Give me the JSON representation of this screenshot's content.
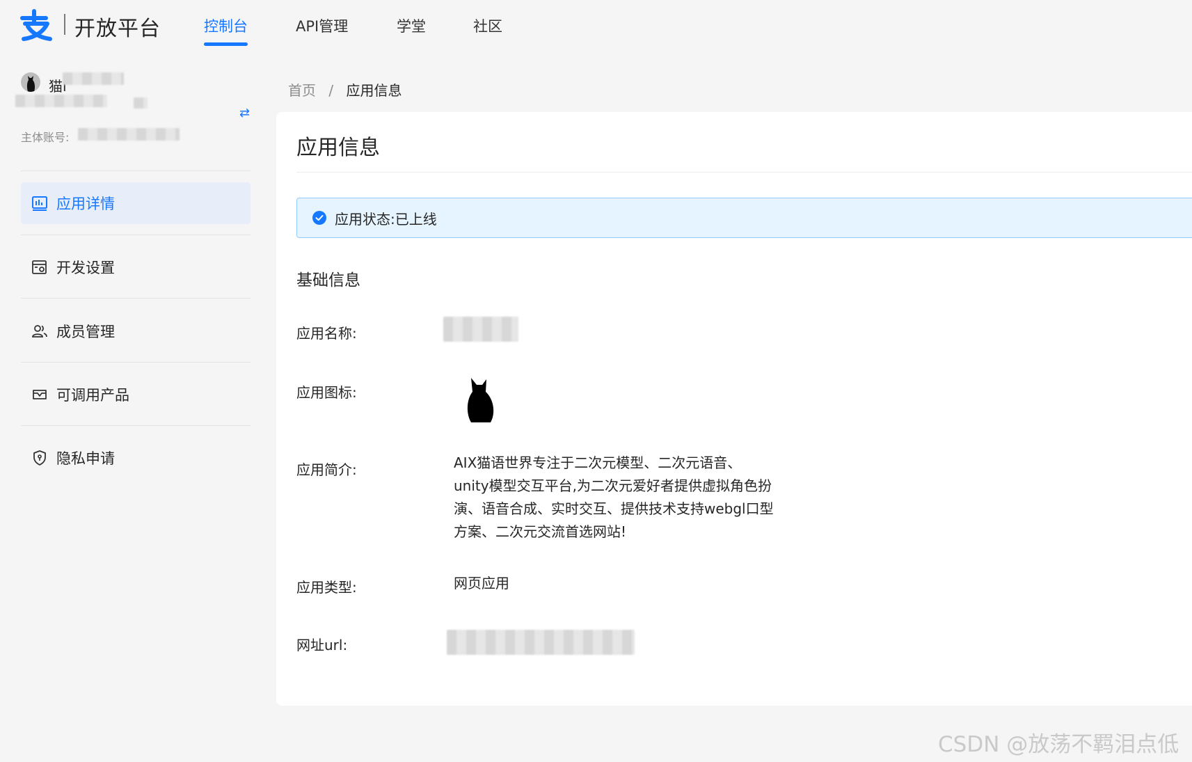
{
  "brand": {
    "logo_char": "支",
    "name": "开放平台",
    "accent_color": "#1677ff"
  },
  "nav": {
    "tabs": [
      {
        "label": "控制台",
        "active": true
      },
      {
        "label": "API管理",
        "active": false
      },
      {
        "label": "学堂",
        "active": false
      },
      {
        "label": "社区",
        "active": false
      }
    ]
  },
  "user": {
    "name_visible": "猫i",
    "account_label": "主体账号:",
    "avatar_icon": "cat-silhouette-icon",
    "switch_icon": "swap-icon"
  },
  "sidebar": {
    "items": [
      {
        "label": "应用详情",
        "icon": "chart-board-icon",
        "active": true
      },
      {
        "label": "开发设置",
        "icon": "settings-window-icon",
        "active": false
      },
      {
        "label": "成员管理",
        "icon": "users-icon",
        "active": false
      },
      {
        "label": "可调用产品",
        "icon": "product-icon",
        "active": false
      },
      {
        "label": "隐私申请",
        "icon": "shield-icon",
        "active": false
      }
    ]
  },
  "breadcrumb": {
    "home": "首页",
    "separator": "/",
    "current": "应用信息"
  },
  "main": {
    "title": "应用信息",
    "status": {
      "label": "应用状态:",
      "value": "已上线",
      "icon": "check-circle-icon",
      "bg_color": "#e6f4ff"
    },
    "section_title": "基础信息",
    "fields": {
      "name_label": "应用名称:",
      "icon_label": "应用图标:",
      "desc_label": "应用简介:",
      "desc_value": "AIX猫语世界专注于二次元模型、二次元语音、unity模型交互平台,为二次元爱好者提供虚拟角色扮演、语音合成、实时交互、提供技术支持webgl口型方案、二次元交流首选网站!",
      "type_label": "应用类型:",
      "type_value": "网页应用",
      "url_label": "网址url:"
    }
  },
  "watermark": "CSDN @放荡不羁泪点低"
}
